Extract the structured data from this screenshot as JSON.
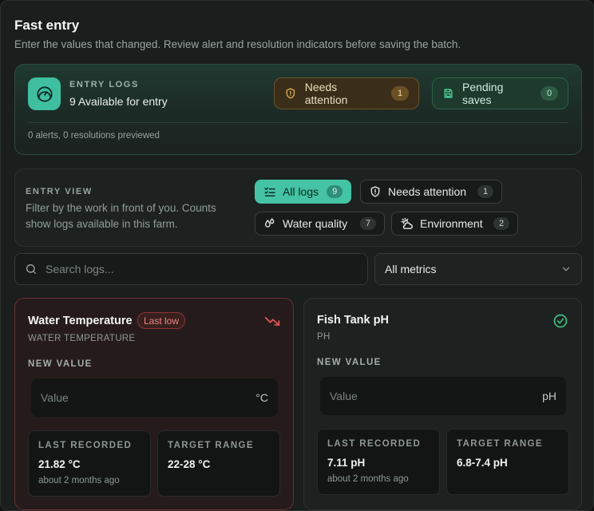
{
  "page": {
    "title": "Fast entry",
    "subtitle": "Enter the values that changed. Review alert and resolution indicators before saving the batch."
  },
  "entry_logs": {
    "label": "ENTRY LOGS",
    "value": "9 Available for entry",
    "icon": "gauge-icon",
    "needs_attention": {
      "label": "Needs attention",
      "count": "1",
      "icon": "shield-alert-icon"
    },
    "pending_saves": {
      "label": "Pending saves",
      "count": "0",
      "icon": "save-icon"
    },
    "footer": "0 alerts, 0 resolutions previewed"
  },
  "entry_view": {
    "label": "ENTRY VIEW",
    "description": "Filter by the work in front of you. Counts show logs available in this farm.",
    "filters": [
      {
        "label": "All logs",
        "count": "9",
        "icon": "list-check-icon",
        "active": true
      },
      {
        "label": "Needs attention",
        "count": "1",
        "icon": "shield-alert-icon",
        "active": false
      },
      {
        "label": "Water quality",
        "count": "7",
        "icon": "droplets-icon",
        "active": false
      },
      {
        "label": "Environment",
        "count": "2",
        "icon": "sun-cloud-icon",
        "active": false
      }
    ]
  },
  "search": {
    "placeholder": "Search logs..."
  },
  "metric_select": {
    "value": "All metrics"
  },
  "cards": [
    {
      "title": "Water Temperature",
      "badge": "Last low",
      "subtitle": "WATER TEMPERATURE",
      "new_value_label": "NEW VALUE",
      "placeholder": "Value",
      "unit": "°C",
      "last_recorded_label": "LAST RECORDED",
      "last_recorded_value": "21.82 °C",
      "last_recorded_time": "about 2 months ago",
      "target_label": "TARGET RANGE",
      "target_value": "22-28 °C",
      "status_icon": "trending-down-icon",
      "status_color": "#e0524f"
    },
    {
      "title": "Fish Tank pH",
      "subtitle": "PH",
      "new_value_label": "NEW VALUE",
      "placeholder": "Value",
      "unit": "pH",
      "last_recorded_label": "LAST RECORDED",
      "last_recorded_value": "7.11 pH",
      "last_recorded_time": "about 2 months ago",
      "target_label": "TARGET RANGE",
      "target_value": "6.8-7.4 pH",
      "status_icon": "check-circle-icon",
      "status_color": "#3fc37f"
    }
  ],
  "colors": {
    "accent": "#45c4a5",
    "alert": "#e0524f",
    "warning": "#d9a043",
    "success": "#3fc37f"
  }
}
